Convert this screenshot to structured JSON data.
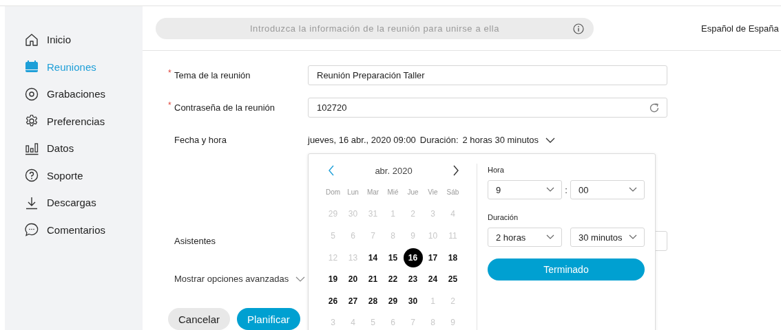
{
  "sidebar": {
    "items": [
      {
        "label": "Inicio",
        "selected": false
      },
      {
        "label": "Reuniones",
        "selected": true
      },
      {
        "label": "Grabaciones",
        "selected": false
      },
      {
        "label": "Preferencias",
        "selected": false
      },
      {
        "label": "Datos",
        "selected": false
      },
      {
        "label": "Soporte",
        "selected": false
      },
      {
        "label": "Descargas",
        "selected": false
      },
      {
        "label": "Comentarios",
        "selected": false
      }
    ]
  },
  "header": {
    "search": {
      "placeholder": "Introduzca la información de la reunión para unirse a ella"
    },
    "language": "Español de España"
  },
  "form": {
    "required_mark": "*",
    "fields": [
      {
        "label": "Tema de la reunión",
        "required": true,
        "value": "Reunión Preparación Taller",
        "kind": "text"
      },
      {
        "label": "Contraseña de la reunión",
        "required": true,
        "value": "102720",
        "kind": "password"
      }
    ],
    "date_time": {
      "label": "Fecha y hora",
      "value": "jueves, 16 abr., 2020 09:00",
      "duration_label": "Duración:",
      "duration_value": "2 horas 30 minutos",
      "expanded": true
    },
    "attendees": {
      "label": "Asistentes"
    },
    "advanced": {
      "label": "Mostrar opciones avanzadas",
      "expanded": false
    },
    "buttons": [
      {
        "label": "Cancelar",
        "kind": "secondary"
      },
      {
        "label": "Planificar",
        "kind": "primary"
      }
    ]
  },
  "date_picker": {
    "month": "abr. 2020",
    "weekdays": [
      "Dom",
      "Lun",
      "Mar",
      "Mié",
      "Jue",
      "Vie",
      "Sáb"
    ],
    "weeks": [
      [
        {
          "label": "29",
          "disabled": true,
          "selected": false
        },
        {
          "label": "30",
          "disabled": true,
          "selected": false
        },
        {
          "label": "31",
          "disabled": true,
          "selected": false
        },
        {
          "label": "1",
          "disabled": true,
          "selected": false
        },
        {
          "label": "2",
          "disabled": true,
          "selected": false
        },
        {
          "label": "3",
          "disabled": true,
          "selected": false
        },
        {
          "label": "4",
          "disabled": true,
          "selected": false
        }
      ],
      [
        {
          "label": "5",
          "disabled": true,
          "selected": false
        },
        {
          "label": "6",
          "disabled": true,
          "selected": false
        },
        {
          "label": "7",
          "disabled": true,
          "selected": false
        },
        {
          "label": "8",
          "disabled": true,
          "selected": false
        },
        {
          "label": "9",
          "disabled": true,
          "selected": false
        },
        {
          "label": "10",
          "disabled": true,
          "selected": false
        },
        {
          "label": "11",
          "disabled": true,
          "selected": false
        }
      ],
      [
        {
          "label": "12",
          "disabled": true,
          "selected": false
        },
        {
          "label": "13",
          "disabled": true,
          "selected": false
        },
        {
          "label": "14",
          "disabled": false,
          "selected": false
        },
        {
          "label": "15",
          "disabled": false,
          "selected": false
        },
        {
          "label": "16",
          "disabled": false,
          "selected": true
        },
        {
          "label": "17",
          "disabled": false,
          "selected": false
        },
        {
          "label": "18",
          "disabled": false,
          "selected": false
        }
      ],
      [
        {
          "label": "19",
          "disabled": false,
          "selected": false
        },
        {
          "label": "20",
          "disabled": false,
          "selected": false
        },
        {
          "label": "21",
          "disabled": false,
          "selected": false
        },
        {
          "label": "22",
          "disabled": false,
          "selected": false
        },
        {
          "label": "23",
          "disabled": false,
          "selected": false
        },
        {
          "label": "24",
          "disabled": false,
          "selected": false
        },
        {
          "label": "25",
          "disabled": false,
          "selected": false
        }
      ],
      [
        {
          "label": "26",
          "disabled": false,
          "selected": false
        },
        {
          "label": "27",
          "disabled": false,
          "selected": false
        },
        {
          "label": "28",
          "disabled": false,
          "selected": false
        },
        {
          "label": "29",
          "disabled": false,
          "selected": false
        },
        {
          "label": "30",
          "disabled": false,
          "selected": false
        },
        {
          "label": "1",
          "disabled": true,
          "selected": false
        },
        {
          "label": "2",
          "disabled": true,
          "selected": false
        }
      ],
      [
        {
          "label": "3",
          "disabled": true,
          "selected": false
        },
        {
          "label": "4",
          "disabled": true,
          "selected": false
        },
        {
          "label": "5",
          "disabled": true,
          "selected": false
        },
        {
          "label": "6",
          "disabled": true,
          "selected": false
        },
        {
          "label": "7",
          "disabled": true,
          "selected": false
        },
        {
          "label": "8",
          "disabled": true,
          "selected": false
        },
        {
          "label": "9",
          "disabled": true,
          "selected": false
        }
      ]
    ],
    "time": {
      "label": "Hora",
      "hour": "9",
      "separator": ":",
      "minute": "00"
    },
    "duration": {
      "label": "Duración",
      "hours": "2 horas",
      "minutes": "30 minutos"
    },
    "done_button": "Terminado"
  }
}
